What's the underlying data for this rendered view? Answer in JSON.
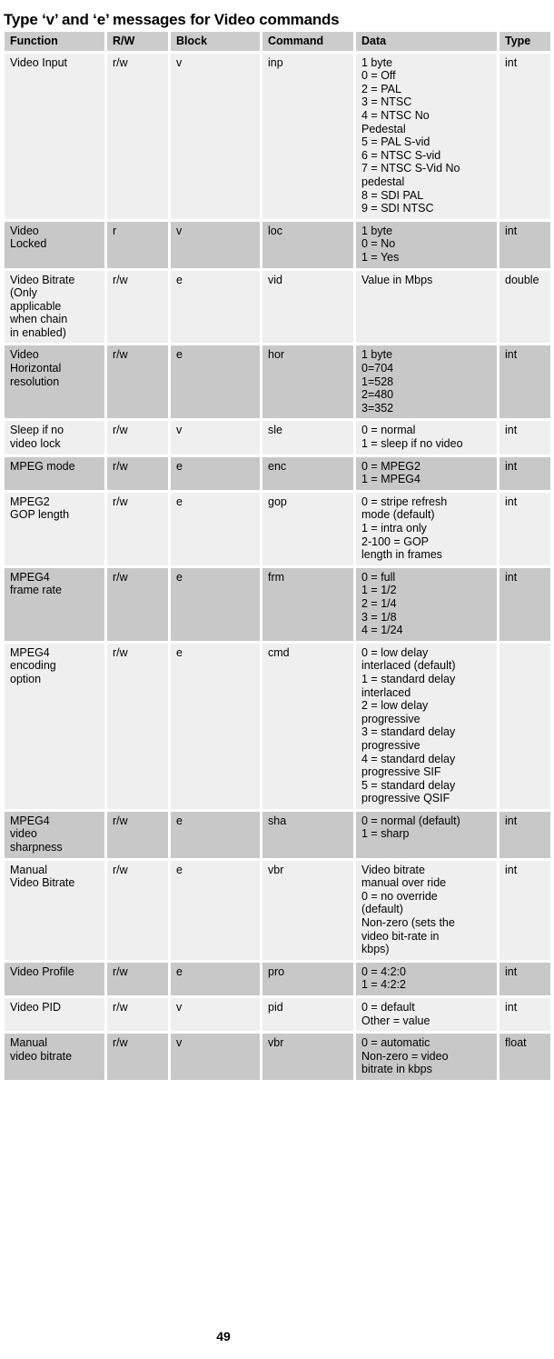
{
  "document": {
    "title": "Type ‘v’ and ‘e’ messages for Video commands",
    "page_number": "49"
  },
  "table": {
    "columns": [
      "Function",
      "R/W",
      "Block",
      "Command",
      "Data",
      "Type"
    ],
    "rows": [
      {
        "function": "Video Input",
        "rw": "r/w",
        "block": "v",
        "command": "inp",
        "data": "1 byte\n0 = Off\n2 = PAL\n3 = NTSC\n4 = NTSC No\nPedestal\n5 = PAL S-vid\n6 = NTSC S-vid\n7 = NTSC S-Vid No\npedestal\n8 = SDI PAL\n9 = SDI NTSC",
        "type": "int",
        "shade": "light"
      },
      {
        "function": "Video\nLocked",
        "rw": "r",
        "block": "v",
        "command": "loc",
        "data": "1 byte\n0 = No\n1 = Yes",
        "type": "int",
        "shade": "dark"
      },
      {
        "function": "Video Bitrate\n(Only\napplicable\nwhen chain\nin enabled)",
        "rw": "r/w",
        "block": "e",
        "command": "vid",
        "data": "Value in Mbps",
        "type": "double",
        "shade": "light"
      },
      {
        "function": "Video\nHorizontal\nresolution",
        "rw": "r/w",
        "block": "e",
        "command": "hor",
        "data": "1 byte\n0=704\n1=528\n2=480\n3=352",
        "type": "int",
        "shade": "dark"
      },
      {
        "function": "Sleep if no\nvideo lock",
        "rw": "r/w",
        "block": "v",
        "command": "sle",
        "data": "0 = normal\n1 = sleep if no video",
        "type": "int",
        "shade": "light"
      },
      {
        "function": "MPEG mode",
        "rw": "r/w",
        "block": "e",
        "command": "enc",
        "data": "0 = MPEG2\n1 = MPEG4",
        "type": "int",
        "shade": "dark"
      },
      {
        "function": "MPEG2\nGOP length",
        "rw": "r/w",
        "block": "e",
        "command": "gop",
        "data": "0 = stripe refresh\nmode (default)\n1 = intra only\n2-100 = GOP\nlength in frames",
        "type": "int",
        "shade": "light"
      },
      {
        "function": "MPEG4\nframe rate",
        "rw": "r/w",
        "block": "e",
        "command": "frm",
        "data": "0 = full\n1 = 1/2\n2 = 1/4\n3 = 1/8\n4 = 1/24",
        "type": "int",
        "shade": "dark"
      },
      {
        "function": "MPEG4\nencoding\noption",
        "rw": "r/w",
        "block": "e",
        "command": "cmd",
        "data": "0 = low delay\ninterlaced (default)\n1 = standard delay\ninterlaced\n2 = low delay\nprogressive\n3 = standard delay\nprogressive\n4 = standard delay\nprogressive SIF\n5 = standard delay\nprogressive QSIF",
        "type": "",
        "shade": "light"
      },
      {
        "function": "MPEG4\nvideo\nsharpness",
        "rw": "r/w",
        "block": "e",
        "command": "sha",
        "data": "0 = normal (default)\n1 = sharp",
        "type": "int",
        "shade": "dark"
      },
      {
        "function": "Manual\nVideo Bitrate",
        "rw": "r/w",
        "block": "e",
        "command": "vbr",
        "data": "Video bitrate\nmanual over ride\n0 = no override\n(default)\nNon-zero (sets the\nvideo bit-rate in\nkbps)",
        "type": "int",
        "shade": "light"
      },
      {
        "function": "Video Profile",
        "rw": "r/w",
        "block": "e",
        "command": "pro",
        "data": "0 = 4:2:0\n1 = 4:2:2",
        "type": "int",
        "shade": "dark"
      },
      {
        "function": "Video PID",
        "rw": "r/w",
        "block": "v",
        "command": "pid",
        "data": "0 = default\nOther = value",
        "type": "int",
        "shade": "light"
      },
      {
        "function": "Manual\nvideo bitrate",
        "rw": "r/w",
        "block": "v",
        "command": "vbr",
        "data": "0 = automatic\nNon-zero = video\nbitrate in kbps",
        "type": "float",
        "shade": "dark"
      }
    ]
  }
}
